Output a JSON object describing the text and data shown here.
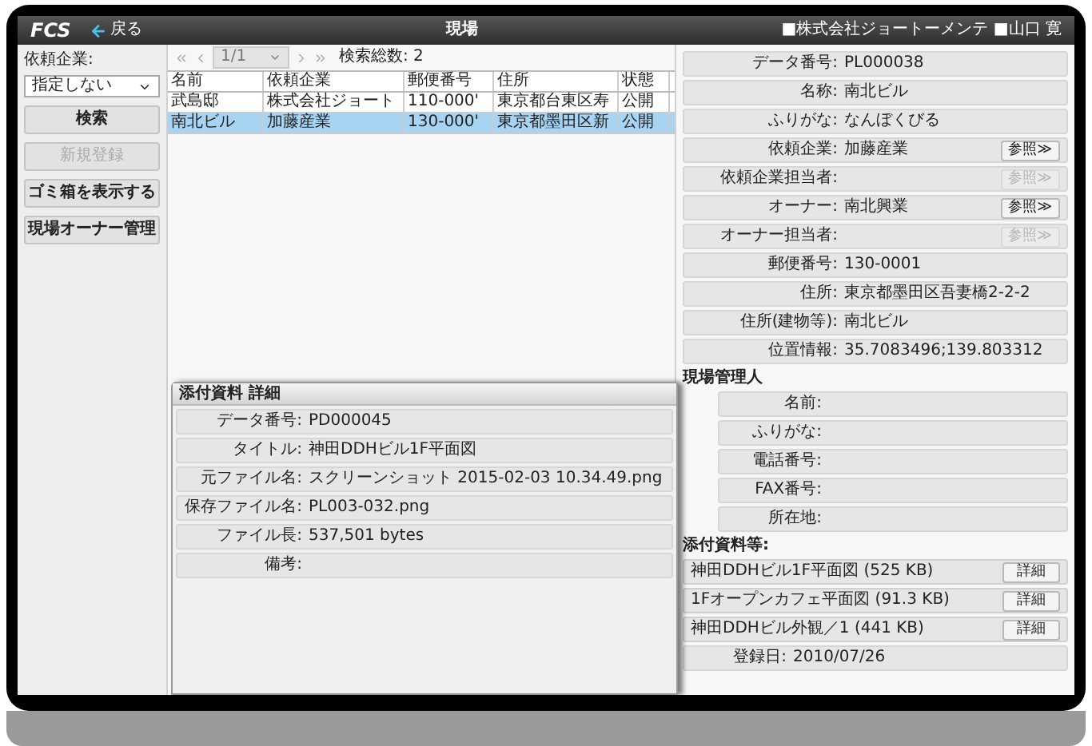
{
  "header": {
    "logo": "FCS",
    "back": "戻る",
    "title": "現場",
    "user": "■株式会社ジョートーメンテ ■山口 寛"
  },
  "sidebar": {
    "filter_label": "依頼企業:",
    "filter_value": "指定しない",
    "buttons": [
      {
        "label": "検索",
        "disabled": false
      },
      {
        "label": "新規登録",
        "disabled": true
      },
      {
        "label": "ゴミ箱を表示する",
        "disabled": false
      },
      {
        "label": "現場オーナー管理",
        "disabled": false
      }
    ]
  },
  "pager": {
    "page": "1/1",
    "total": "検索総数: 2"
  },
  "table": {
    "columns": [
      "名前",
      "依頼企業",
      "郵便番号",
      "住所",
      "状態"
    ],
    "rows": [
      {
        "cells": [
          "武島邸",
          "株式会社ジョート",
          "110-000'",
          "東京都台東区寿",
          "公開"
        ],
        "selected": false
      },
      {
        "cells": [
          "南北ビル",
          "加藤産業",
          "130-000'",
          "東京都墨田区新",
          "公開"
        ],
        "selected": true
      }
    ]
  },
  "details": {
    "fields": [
      {
        "label": "データ番号:",
        "value": "PL000038"
      },
      {
        "label": "名称:",
        "value": "南北ビル"
      },
      {
        "label": "ふりがな:",
        "value": "なんぼくびる"
      },
      {
        "label": "依頼企業:",
        "value": "加藤産業",
        "ref_button": {
          "label": "参照≫",
          "disabled": false
        }
      },
      {
        "label": "依頼企業担当者:",
        "ref_button": {
          "label": "参照≫",
          "disabled": true
        }
      },
      {
        "label": "オーナー:",
        "value": "南北興業",
        "ref_button": {
          "label": "参照≫",
          "disabled": false
        }
      },
      {
        "label": "オーナー担当者:",
        "ref_button": {
          "label": "参照≫",
          "disabled": true
        }
      },
      {
        "label": "郵便番号:",
        "value": "130-0001"
      },
      {
        "label": "住所:",
        "value": "東京都墨田区吾妻橋2-2-2"
      },
      {
        "label": "住所(建物等):",
        "value": "南北ビル"
      },
      {
        "label": "位置情報:",
        "value": "35.7083496;139.803312"
      }
    ],
    "manager": {
      "title": "現場管理人",
      "fields": [
        {
          "label": "名前:"
        },
        {
          "label": "ふりがな:"
        },
        {
          "label": "電話番号:"
        },
        {
          "label": "FAX番号:"
        },
        {
          "label": "所在地:"
        }
      ]
    },
    "attachments": {
      "title": "添付資料等:",
      "items": [
        {
          "name": "神田DDHビル1F平面図 (525 KB)",
          "button": "詳細"
        },
        {
          "name": "1Fオープンカフェ平面図 (91.3 KB)",
          "button": "詳細"
        },
        {
          "name": "神田DDHビル外観／1 (441 KB)",
          "button": "詳細"
        }
      ]
    },
    "registered": {
      "label": "登録日:",
      "value": "2010/07/26"
    }
  },
  "popup": {
    "title": "添付資料 詳細",
    "fields": [
      {
        "label": "データ番号:",
        "value": "PD000045"
      },
      {
        "label": "タイトル:",
        "value": "神田DDHビル1F平面図"
      },
      {
        "label": "元ファイル名:",
        "value": "スクリーンショット 2015-02-03 10.34.49.png"
      },
      {
        "label": "保存ファイル名:",
        "value": "PL003-032.png"
      },
      {
        "label": "ファイル長:",
        "value": "537,501 bytes"
      },
      {
        "label": "備考:"
      }
    ]
  }
}
